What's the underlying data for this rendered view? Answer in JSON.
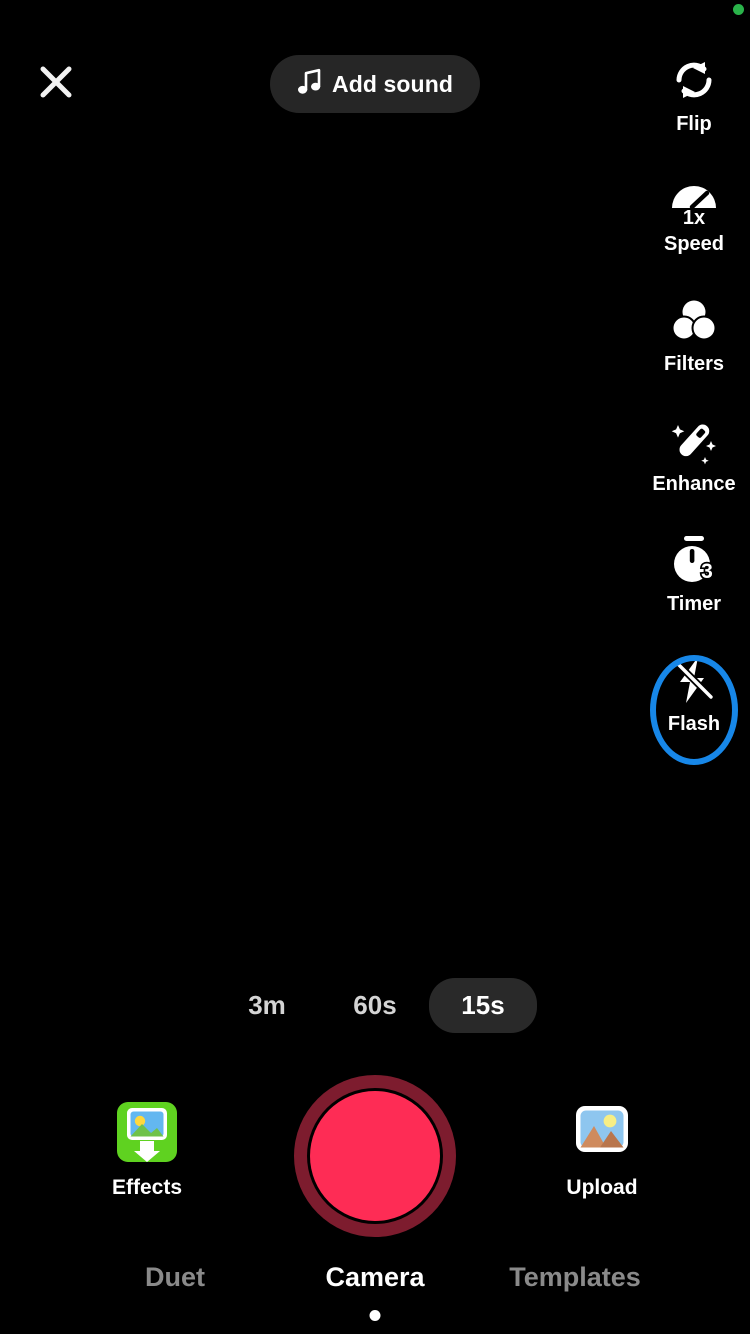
{
  "app": {
    "screen_name": "Camera",
    "background_color": "#000000",
    "accent_record_color": "#FE2C55",
    "highlight_ring_color": "#1787E8"
  },
  "status": {
    "indicator_name": "recording-privacy-dot",
    "color": "#2AB34A"
  },
  "header": {
    "close_icon": "close-x-icon",
    "add_sound": {
      "label": "Add sound",
      "icon": "music-note-icon"
    }
  },
  "right_rail": {
    "items": [
      {
        "label": "Flip",
        "icon": "camera-flip-icon",
        "selected": false,
        "badge": ""
      },
      {
        "label": "Speed",
        "icon": "speedometer-icon",
        "selected": false,
        "badge": "1x"
      },
      {
        "label": "Filters",
        "icon": "filters-circles-icon",
        "selected": false,
        "badge": ""
      },
      {
        "label": "Enhance",
        "icon": "magic-wand-icon",
        "selected": false,
        "badge": ""
      },
      {
        "label": "Timer",
        "icon": "stopwatch-icon",
        "selected": false,
        "badge": "3"
      },
      {
        "label": "Flash",
        "icon": "flash-off-icon",
        "selected": true,
        "badge": ""
      }
    ]
  },
  "durations": {
    "options": [
      {
        "label": "3m",
        "selected": false
      },
      {
        "label": "60s",
        "selected": false
      },
      {
        "label": "15s",
        "selected": true
      }
    ]
  },
  "capture": {
    "record_button_name": "record-button",
    "effects": {
      "label": "Effects",
      "icon": "effects-green-photo-icon"
    },
    "upload": {
      "label": "Upload",
      "icon": "photo-gallery-icon"
    }
  },
  "bottom_tabs": {
    "items": [
      {
        "label": "Duet",
        "active": false
      },
      {
        "label": "Camera",
        "active": true
      },
      {
        "label": "Templates",
        "active": false
      }
    ]
  }
}
